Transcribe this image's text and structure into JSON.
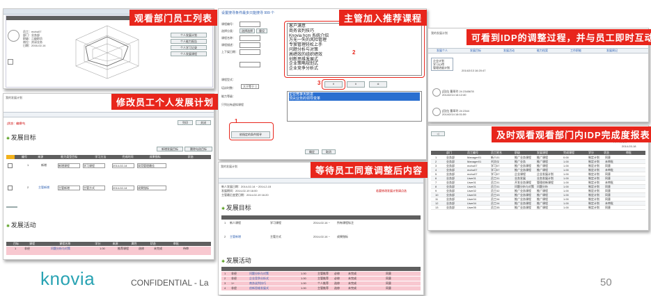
{
  "captions": {
    "c1": "观看部门员工列表",
    "c2": "主管加入推荐课程",
    "c3": "可看到IDP的调整过程，并与员工即时互动",
    "c4": "修改员工个人发展计划",
    "c5": "等待员工同意调整后内容",
    "c6": "及时观看观看部门内IDP完成度报表"
  },
  "footer": {
    "logo": "knovia",
    "confidential": "CONFIDENTIAL - La",
    "page": "50"
  },
  "panel2": {
    "title": "设置搜寻条件最多只能搜寻 999 个",
    "labels": [
      "课程编号：",
      "选择分类：",
      "课程名称：",
      "课程描述：",
      "上下架日期：",
      "",
      "",
      "课程型式：",
      "培训时数：",
      "能力等级：",
      "只列出有虚拟课程"
    ],
    "choose_btn": "选择选择",
    "reset_btn": "重设",
    "hours_select": "大于等于 ▽",
    "search_btn": "依指定的条件搜寻",
    "list_items": [
      "客户满意",
      "商务谈判技巧",
      "Knovia hcm 系统介绍",
      "万无一失的风险管理",
      "专案管理轻松上手",
      "问题分析与对策",
      "高绩效的组织绩效",
      "创新思维发展式",
      "企业策略规划式",
      "企业竞争分析式"
    ],
    "selected_items": [
      "企业竞争大跃进",
      "顶尖业务的领导变革"
    ],
    "arrow_buttons": [
      "∨",
      "∧",
      "≑"
    ],
    "ok_btn": "确定",
    "cancel_btn": "取消",
    "marker1": "1",
    "marker2": "2",
    "marker3": "3"
  },
  "panel4": {
    "status": "[状态：编辑中]",
    "section1": "发展目标",
    "section2": "发展活动",
    "add_goal_btn": "新增发展目标",
    "cancel_goal_btn": "删除勾选目标",
    "print_btn": "列印",
    "close_btn": "关闭",
    "row1_id": "1",
    "row1_type": "新增",
    "row2_id": "2",
    "row2_type": "主管新增",
    "date_a": "2014-02-14",
    "date_b": "2014-02-14",
    "date_c": "2014-02-14",
    "text_1": "新增课程",
    "text_2": "主管新增",
    "text_3": "学习课程",
    "text_4": "主管方式",
    "text_5": "采用管理最佳",
    "text_6": "成果指标",
    "col_headers": [
      "编号",
      "来源",
      "能力类型目标",
      "学习方法",
      "完成时间",
      "成果指标",
      "状态"
    ],
    "act_headers": [
      "目标",
      "课程",
      "课程名称",
      "学分",
      "来源",
      "属性",
      "状态",
      "审批"
    ],
    "act_row": [
      "1",
      "非经",
      "问题分析与对策",
      "1.00",
      "推荐课程",
      "选修",
      "未完成",
      "待审"
    ]
  },
  "panel5": {
    "top_rows": [
      "新人发展日期：2014-02-14 ~ 2014-2-15",
      "发展期间：2014-02-19 16:00",
      "主管最后变更日期：2014-02-19 16:20"
    ],
    "right_note": "若要修改发展计划请点选",
    "section1": "发展目标",
    "section2": "发展活动",
    "goal_row1": [
      "1",
      "新人课程",
      "学习课程",
      "2014-02-14 ~",
      "所有课程标注"
    ],
    "goal_row2": [
      "2",
      "主管新增",
      "主管方式",
      "2014-02-14 ~",
      "成果指标"
    ],
    "act_rows": [
      [
        "1",
        "非经",
        "问题分析与对策",
        "1.00",
        "主管推荐",
        "必修",
        "未完成",
        "同意"
      ],
      [
        "2",
        "非经",
        "企业竞争分析式",
        "1.00",
        "主管推荐",
        "必修",
        "未完成",
        "同意"
      ],
      [
        "3",
        "1+",
        "商务谈判技巧",
        "1.00",
        "个人推荐",
        "选修",
        "未完成",
        "同意"
      ],
      [
        "4",
        "非经",
        "创新思维发展式",
        "1.00",
        "主管推荐",
        "选修",
        "未完成",
        "同意"
      ]
    ]
  },
  "panel3": {
    "tabs": [
      "发展个人",
      "发展目标",
      "发展活动",
      "能力档案",
      "工作职能",
      "发展周记"
    ],
    "entries": [
      [
        "企业计划",
        "学习心得",
        "管理进度计划",
        "2014/2/13 16:20:47"
      ],
      [
        "[回应] 曹翠玲 24 2345678",
        "2014/2/14 16:12:40"
      ],
      [
        "[回应] 曹翠玲 24 2344",
        "2014/2/14 16:01:59"
      ]
    ]
  },
  "panel6": {
    "header_right": "列印 | 关闭",
    "date": "2014-03-18",
    "columns": [
      "部门",
      "员工编号",
      "员工姓名",
      "职级",
      "发展课程",
      "完成课程",
      "学分",
      "状态",
      "审批"
    ],
    "rows": [
      [
        "1",
        "业务部",
        "Manager01",
        "新人01",
        "推广业务课程",
        "推广课程",
        "0.00",
        "制定计划",
        "同意"
      ],
      [
        "2",
        "业务部",
        "Manager01",
        "刘文仪",
        "推广业务",
        "推广课程",
        "1.00",
        "制定计划",
        "未审批"
      ],
      [
        "3",
        "业务部",
        "mohu07",
        "学习07",
        "推广业务课程",
        "推广课程",
        "1.00",
        "制定计划",
        "同意"
      ],
      [
        "4",
        "业务部",
        "mohu07",
        "学习07",
        "推广业务课程",
        "推广课程",
        "1.00",
        "制定计划",
        "未审批"
      ],
      [
        "5",
        "业务部",
        "mohu07",
        "学习07",
        "企业课程",
        "企业发展计划",
        "1.00",
        "制定计划",
        "同意"
      ],
      [
        "6",
        "业务部",
        "User01",
        "员工01",
        "业务发展",
        "业务发展计划",
        "1.00",
        "制定计划",
        "同意"
      ],
      [
        "7",
        "业务部",
        "User01",
        "员工01",
        "开发业务课程",
        "管理创新课程",
        "1.00",
        "制定计划",
        "未审批"
      ],
      [
        "8",
        "业务部",
        "User01",
        "员工01",
        "问题分析与对策",
        "问题分析",
        "1.00",
        "制定计划",
        "同意"
      ],
      [
        "9",
        "业务部",
        "User02",
        "员工02",
        "推广业务课程",
        "推广课程",
        "1.00",
        "制定计划",
        "同意"
      ],
      [
        "10",
        "业务部",
        "User03",
        "员工03",
        "推广业务课程",
        "推广课程",
        "1.00",
        "制定计划",
        "同意"
      ],
      [
        "11",
        "业务部",
        "User04",
        "员工04",
        "推广业务课程",
        "推广课程",
        "1.00",
        "制定计划",
        "同意"
      ],
      [
        "12",
        "业务部",
        "User04",
        "员工04",
        "推广业务课程",
        "推广课程",
        "1.00",
        "制定计划",
        "未审批"
      ],
      [
        "13",
        "业务部",
        "User05",
        "员工05",
        "推广业务课程",
        "推广课程",
        "1.00",
        "制定计划",
        "同意"
      ]
    ]
  },
  "panel1": {
    "toolbar_items": [
      "下载",
      "关闭"
    ],
    "buttons": [
      "个人发展计划",
      "个人能力报告",
      "个人学习记录",
      "个人发展课程"
    ],
    "emp_info": [
      "员工：mohu07",
      "部门：业务部",
      "职级：二级职员",
      "岗位：资深业务",
      "日期：2016-02-14"
    ]
  }
}
